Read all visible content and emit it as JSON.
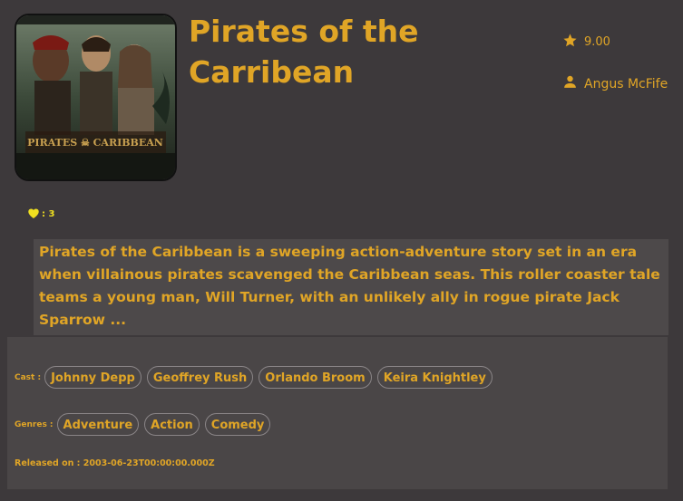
{
  "movie": {
    "title": "Pirates of the Carribean",
    "rating": "9.00",
    "user": "Angus McFife",
    "likes": ": 3",
    "description": "Pirates of the Caribbean is a sweeping action-adventure story set in an era when villainous pirates scavenged the Caribbean seas. This roller coaster tale teams a young man, Will Turner, with an unlikely ally in rogue pirate Jack Sparrow ...",
    "cast_label": "Cast :",
    "cast": [
      "Johnny Depp",
      "Geoffrey Rush",
      "Orlando Broom",
      "Keira Knightley"
    ],
    "genres_label": "Genres :",
    "genres": [
      "Adventure",
      "Action",
      "Comedy"
    ],
    "released_label": "Released on :",
    "released_date": "2003-06-23T00:00:00.000Z"
  },
  "icons": {
    "rating": "star-icon",
    "user": "person-icon",
    "likes": "heart-icon"
  },
  "colors": {
    "background": "#3d393b",
    "accent": "#e0a526",
    "panel": "#4a4647",
    "heart": "#f0e020"
  }
}
